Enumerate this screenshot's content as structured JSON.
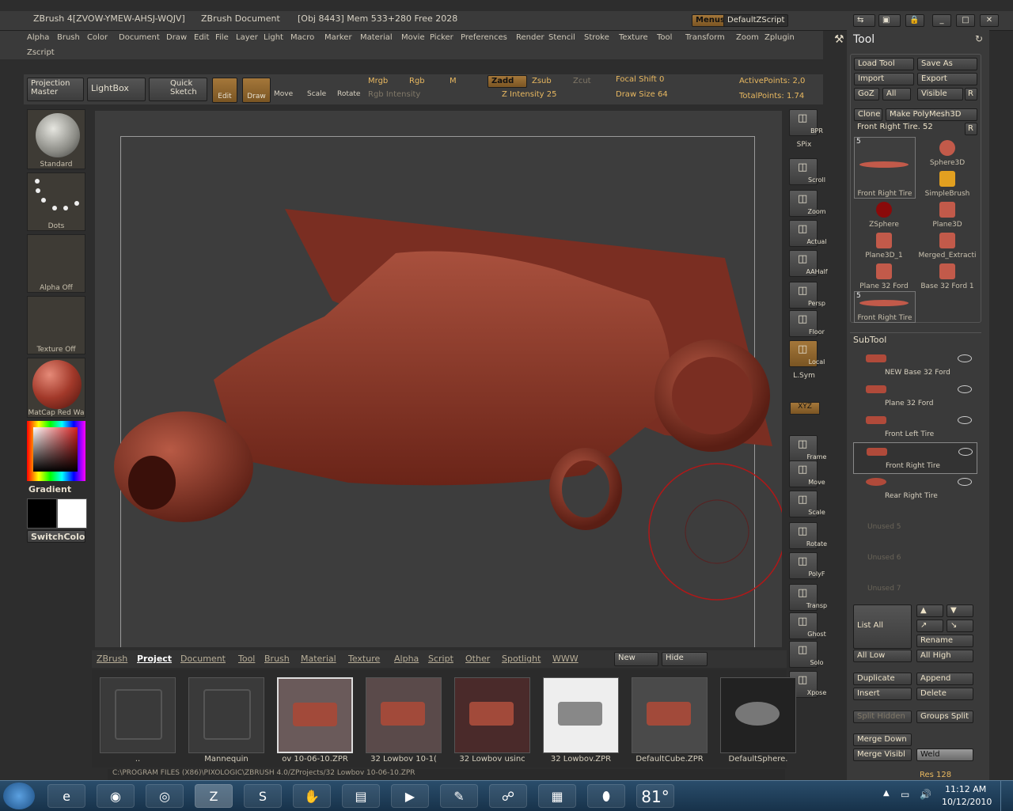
{
  "titlebar": {
    "app": "ZBrush 4[ZVOW-YMEW-AHSJ-WQJV]",
    "doc": "ZBrush Document",
    "obj": "[Obj 8443] Mem 533+280 Free 2028",
    "menus": "Menus",
    "script": "DefaultZScript"
  },
  "menu": {
    "items": [
      "Alpha",
      "Brush",
      "Color",
      "Document",
      "Draw",
      "Edit",
      "File",
      "Layer",
      "Light",
      "Macro",
      "Marker",
      "Material",
      "Movie",
      "Picker",
      "Preferences",
      "Render",
      "Stencil",
      "Stroke",
      "Texture",
      "Tool",
      "Transform",
      "Zoom",
      "Zplugin"
    ],
    "zscript": "Zscript"
  },
  "toolbar": {
    "projection_master": "Projection Master",
    "lightbox": "LightBox",
    "quick_sketch": "Quick Sketch",
    "edit": "Edit",
    "draw": "Draw",
    "move": "Move",
    "scale": "Scale",
    "rotate": "Rotate",
    "mrgb": "Mrgb",
    "rgb": "Rgb",
    "m": "M",
    "rgb_intensity": "Rgb Intensity",
    "zadd": "Zadd",
    "zsub": "Zsub",
    "zcut": "Zcut",
    "z_intensity": "Z Intensity",
    "z_intensity_value": "25",
    "focal_shift": "Focal Shift",
    "focal_shift_value": "0",
    "draw_size": "Draw Size",
    "draw_size_value": "64",
    "active_points": "ActivePoints: 2,0",
    "total_points": "TotalPoints: 1.74"
  },
  "left": {
    "brush": "Standard",
    "stroke": "Dots",
    "alpha": "Alpha Off",
    "texture": "Texture Off",
    "material": "MatCap Red Wa",
    "gradient": "Gradient",
    "switch_color": "SwitchColor"
  },
  "right_bar": [
    "BPR",
    "SPix",
    "Scroll",
    "Zoom",
    "Actual",
    "AAHalf",
    "Persp",
    "Floor",
    "Local",
    "L.Sym",
    "XYZ",
    "Frame",
    "Move",
    "Scale",
    "Rotate",
    "PolyF",
    "Transp",
    "Ghost",
    "Solo",
    "Xpose"
  ],
  "tool": {
    "title": "Tool",
    "load_tool": "Load Tool",
    "save_as": "Save As",
    "import": "Import",
    "export": "Export",
    "goz": "GoZ",
    "all": "All",
    "visible": "Visible",
    "r": "R",
    "clone": "Clone",
    "make_polymesh": "Make PolyMesh3D",
    "current_tool": "Front Right Tire. 52",
    "thumbs": [
      {
        "label": "Front Right Tire",
        "count": "5"
      },
      {
        "label": "Sphere3D"
      },
      {
        "label": "SimpleBrush"
      },
      {
        "label": "ZSphere"
      },
      {
        "label": "Plane3D"
      },
      {
        "label": "Plane3D_1"
      },
      {
        "label": "Merged_Extracti"
      },
      {
        "label": "Plane 32 Ford"
      },
      {
        "label": "Base 32 Ford 1"
      },
      {
        "label": "Front Right Tire",
        "count": "5"
      }
    ]
  },
  "subtool": {
    "title": "SubTool",
    "items": [
      "NEW Base 32 Ford",
      "Plane 32 Ford",
      "Front Left Tire",
      "Front Right Tire",
      "Rear Right Tire",
      "Unused 5",
      "Unused 6",
      "Unused 7"
    ],
    "list_all": "List All",
    "rename": "Rename",
    "all_low": "All Low",
    "all_high": "All High",
    "duplicate": "Duplicate",
    "append": "Append",
    "insert": "Insert",
    "delete": "Delete",
    "split_hidden": "Split Hidden",
    "groups_split": "Groups Split",
    "merge_down": "Merge Down",
    "merge_visible": "Merge Visibl",
    "weld": "Weld",
    "res": "Res 128"
  },
  "lightbox": {
    "tabs": [
      "ZBrush",
      "Project",
      "Document",
      "Tool",
      "Brush",
      "Material",
      "Texture",
      "Alpha",
      "Script",
      "Other",
      "Spotlight",
      "WWW"
    ],
    "new": "New",
    "hide": "Hide",
    "items": [
      "..",
      "Mannequin",
      "ov 10-06-10.ZPR",
      "32 Lowbov 10-1(",
      "32 Lowbov usinc",
      "32 Lowbov.ZPR",
      "DefaultCube.ZPR",
      "DefaultSphere."
    ],
    "path": "C:\\PROGRAM FILES (X86)\\PIXOLOGIC\\ZBRUSH 4.0/ZProjects/32 Lowbov 10-06-10.ZPR"
  },
  "taskbar": {
    "temp": "81°",
    "time": "11:12 AM",
    "date": "10/12/2010"
  },
  "colors": {
    "accent": "#e8b860",
    "clay": "#8b3a2c",
    "cursor": "#c02020"
  }
}
